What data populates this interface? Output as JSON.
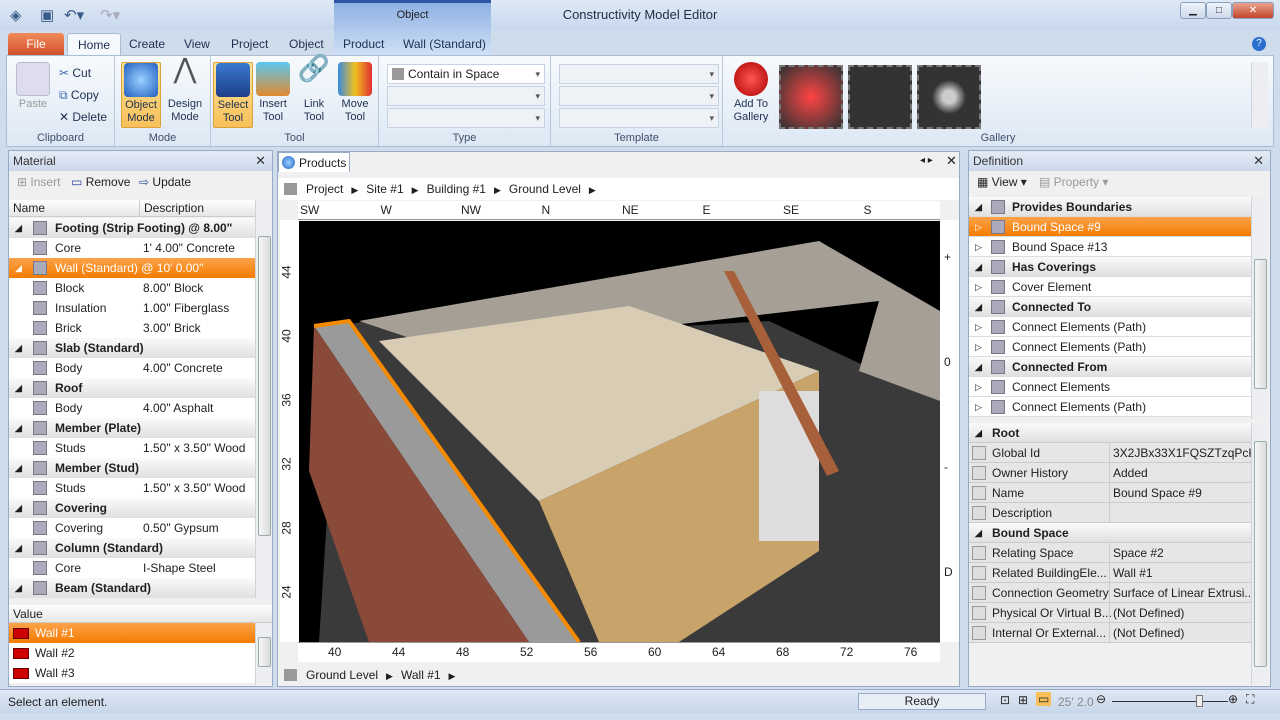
{
  "window": {
    "title": "Constructivity Model Editor",
    "context_tab_group": "Object"
  },
  "tabs": [
    "File",
    "Home",
    "Create",
    "View",
    "Project",
    "Object",
    "Product",
    "Wall (Standard)"
  ],
  "ribbon": {
    "clipboard": {
      "label": "Clipboard",
      "paste": "Paste",
      "cut": "Cut",
      "copy": "Copy",
      "delete": "Delete"
    },
    "mode": {
      "label": "Mode",
      "object": [
        "Object",
        "Mode"
      ],
      "design": [
        "Design",
        "Mode"
      ]
    },
    "tool": {
      "label": "Tool",
      "select": [
        "Select",
        "Tool"
      ],
      "insert": [
        "Insert",
        "Tool"
      ],
      "link": [
        "Link",
        "Tool"
      ],
      "move": [
        "Move",
        "Tool"
      ]
    },
    "type": {
      "label": "Type",
      "combo": "Contain in Space"
    },
    "template": {
      "label": "Template"
    },
    "gallery": {
      "label": "Gallery",
      "add": [
        "Add To",
        "Gallery"
      ]
    }
  },
  "material": {
    "title": "Material",
    "insert": "Insert",
    "remove": "Remove",
    "update": "Update",
    "columns": [
      "Name",
      "Description"
    ],
    "rows": [
      {
        "type": "hdr",
        "name": "Footing (Strip Footing) @ 8.00\""
      },
      {
        "type": "child",
        "name": "Core",
        "desc": "1' 4.00\" Concrete"
      },
      {
        "type": "sel",
        "name": "Wall (Standard) @ 10' 0.00\""
      },
      {
        "type": "child",
        "name": "Block",
        "desc": "8.00\" Block"
      },
      {
        "type": "child",
        "name": "Insulation",
        "desc": "1.00\" Fiberglass"
      },
      {
        "type": "child",
        "name": "Brick",
        "desc": "3.00\" Brick"
      },
      {
        "type": "hdr",
        "name": "Slab (Standard)"
      },
      {
        "type": "child",
        "name": "Body",
        "desc": "4.00\" Concrete"
      },
      {
        "type": "hdr",
        "name": "Roof"
      },
      {
        "type": "child",
        "name": "Body",
        "desc": "4.00\" Asphalt"
      },
      {
        "type": "hdr",
        "name": "Member (Plate)"
      },
      {
        "type": "child",
        "name": "Studs",
        "desc": "1.50\" x 3.50\" Wood"
      },
      {
        "type": "hdr",
        "name": "Member (Stud)"
      },
      {
        "type": "child",
        "name": "Studs",
        "desc": "1.50\" x 3.50\" Wood"
      },
      {
        "type": "hdr",
        "name": "Covering"
      },
      {
        "type": "child",
        "name": "Covering",
        "desc": "0.50\" Gypsum"
      },
      {
        "type": "hdr",
        "name": "Column (Standard)"
      },
      {
        "type": "child",
        "name": "Core",
        "desc": "I-Shape Steel"
      },
      {
        "type": "hdr",
        "name": "Beam (Standard)"
      }
    ],
    "value_header": "Value",
    "values": [
      "Wall #1",
      "Wall #2",
      "Wall #3"
    ]
  },
  "products": {
    "tab": "Products",
    "breadcrumb": [
      "Project",
      "Site #1",
      "Building #1",
      "Ground Level"
    ],
    "compass": [
      "SW",
      "W",
      "NW",
      "N",
      "NE",
      "E",
      "SE",
      "S"
    ],
    "left_ruler": [
      "44",
      "40",
      "36",
      "32",
      "28",
      "24"
    ],
    "bottom_ruler": [
      "40",
      "44",
      "48",
      "52",
      "56",
      "60",
      "64",
      "68",
      "72",
      "76"
    ],
    "right_ruler": [
      "+",
      "0",
      "-",
      "D"
    ],
    "footer_breadcrumb": [
      "Ground Level",
      "Wall #1"
    ]
  },
  "definition": {
    "title": "Definition",
    "view": "View",
    "property": "Property",
    "tree": [
      {
        "type": "hdr",
        "label": "Provides Boundaries"
      },
      {
        "type": "sel",
        "label": "Bound Space #9"
      },
      {
        "type": "child",
        "label": "Bound Space #13"
      },
      {
        "type": "hdr",
        "label": "Has Coverings"
      },
      {
        "type": "child",
        "label": "Cover Element"
      },
      {
        "type": "hdr",
        "label": "Connected To"
      },
      {
        "type": "child",
        "label": "Connect Elements (Path)"
      },
      {
        "type": "child",
        "label": "Connect Elements (Path)"
      },
      {
        "type": "hdr",
        "label": "Connected From"
      },
      {
        "type": "child",
        "label": "Connect Elements"
      },
      {
        "type": "child",
        "label": "Connect Elements (Path)"
      }
    ],
    "props": [
      {
        "type": "hdr",
        "name": "Root"
      },
      {
        "name": "Global Id",
        "value": "3X2JBx33X1FQSZTzqPcK..."
      },
      {
        "name": "Owner History",
        "value": "Added"
      },
      {
        "name": "Name",
        "value": "Bound Space #9"
      },
      {
        "name": "Description",
        "value": ""
      },
      {
        "type": "hdr",
        "name": "Bound Space"
      },
      {
        "name": "Relating Space",
        "value": "Space #2"
      },
      {
        "name": "Related BuildingEle...",
        "value": "Wall #1"
      },
      {
        "name": "Connection Geometry",
        "value": "Surface of Linear Extrusi..."
      },
      {
        "name": "Physical Or Virtual B...",
        "value": "(Not Defined)"
      },
      {
        "name": "Internal Or External...",
        "value": "(Not Defined)"
      }
    ]
  },
  "status": {
    "message": "Select an element.",
    "state": "Ready",
    "scale": "25' 2.0",
    "zoom_slider_fraction": 0.75
  },
  "colors": {
    "selection": "#f57c00",
    "file_tab": "#d3512a"
  }
}
